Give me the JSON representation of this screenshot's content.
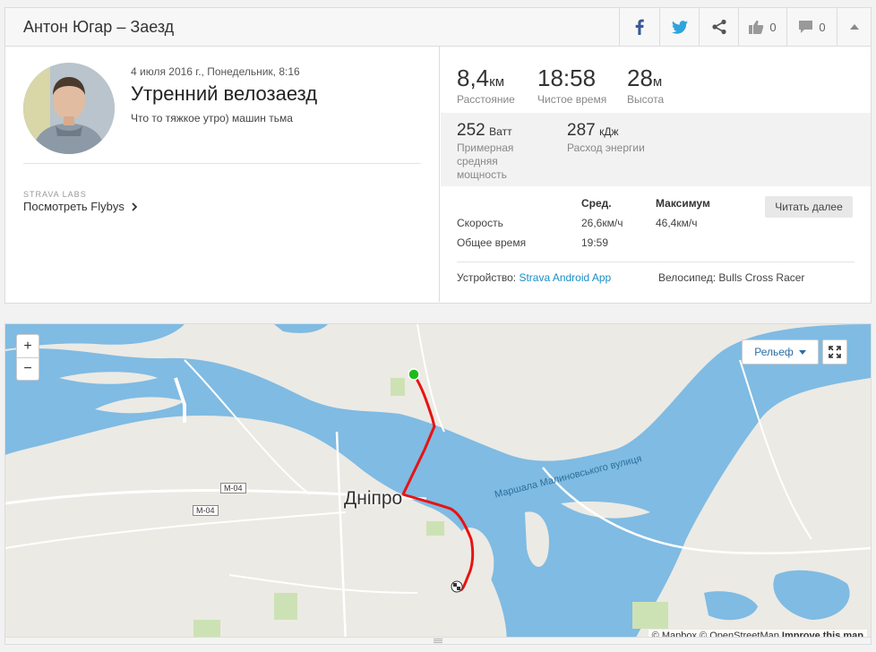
{
  "header": {
    "title": "Антон Югар – Заезд",
    "kudos_count": "0",
    "comments_count": "0"
  },
  "activity": {
    "date": "4 июля 2016 г., Понедельник, 8:16",
    "name": "Утренний велозаезд",
    "description": "Что то тяжкое утро) машин тьма",
    "labs_label": "STRAVA LABS",
    "flybys_link": "Посмотреть Flybys"
  },
  "stats": {
    "distance": {
      "value": "8,4",
      "unit": "км",
      "label": "Расстояние"
    },
    "moving_time": {
      "value": "18:58",
      "unit": "",
      "label": "Чистое время"
    },
    "elevation": {
      "value": "28",
      "unit": "м",
      "label": "Высота"
    },
    "power": {
      "value": "252",
      "unit": "Ватт",
      "label": "Примерная средняя мощность"
    },
    "energy": {
      "value": "287",
      "unit": "кДж",
      "label": "Расход энергии"
    }
  },
  "table": {
    "col_avg": "Сред.",
    "col_max": "Максимум",
    "read_more": "Читать далее",
    "rows": [
      {
        "label": "Скорость",
        "avg": "26,6км/ч",
        "max": "46,4км/ч"
      },
      {
        "label": "Общее время",
        "avg": "19:59",
        "max": ""
      }
    ]
  },
  "footer": {
    "device_label": "Устройство:",
    "device_value": "Strava Android App",
    "bike_label": "Велосипед:",
    "bike_value": "Bulls Cross Racer"
  },
  "map": {
    "zoom_in": "+",
    "zoom_out": "−",
    "layer_button": "Рельеф",
    "city_label": "Дніпро",
    "street_label": "Маршала Малиновського вулиця",
    "road_label_1": "М-04",
    "road_label_2": "М-04",
    "attribution_mapbox": "© Mapbox",
    "attribution_osm": "© OpenStreetMap",
    "attribution_improve": "Improve this map"
  },
  "colors": {
    "water": "#7fbbe3",
    "land": "#eceae4",
    "route": "#e81313",
    "start": "#1dbb1d",
    "link": "#1a8ec4"
  }
}
